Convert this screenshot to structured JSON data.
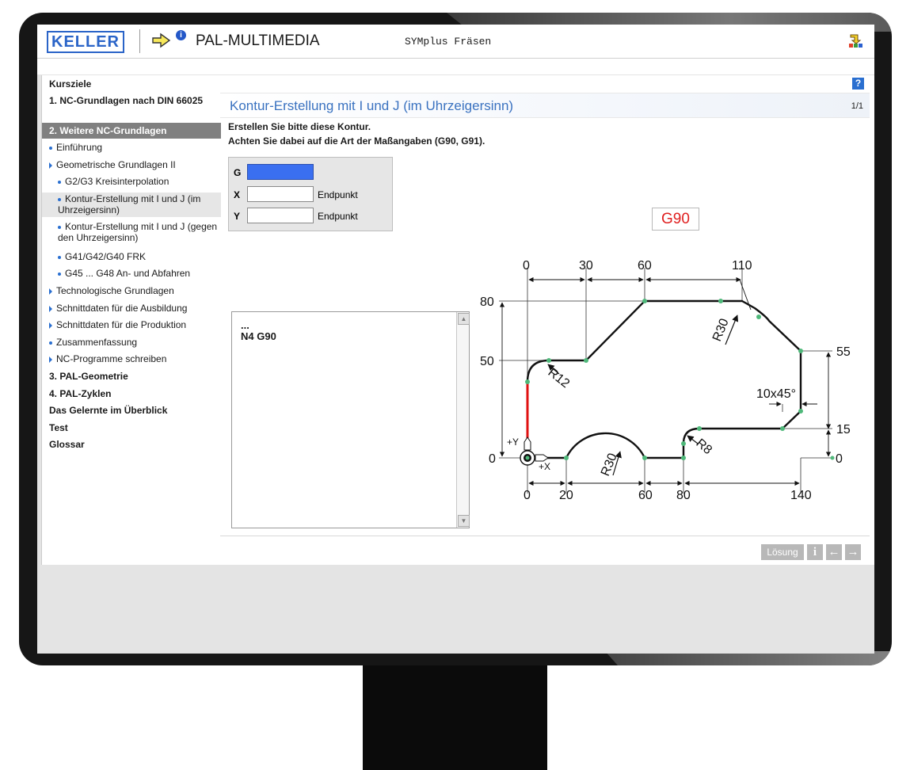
{
  "header": {
    "logo_text": "KELLER",
    "app_title": "PAL-MULTIMEDIA",
    "product": "SYMplus Fräsen",
    "info_badge": "i"
  },
  "nav": {
    "items": [
      {
        "label": "Kursziele"
      },
      {
        "label": "1. NC-Grundlagen nach DIN 66025"
      },
      {
        "label": "2. Weitere NC-Grundlagen"
      },
      {
        "label": "Einführung"
      },
      {
        "label": "Geometrische Grundlagen II"
      },
      {
        "label": "G2/G3 Kreisinterpolation"
      },
      {
        "label": "Kontur-Erstellung mit I und J (im Uhrzeigersinn)"
      },
      {
        "label": "Kontur-Erstellung mit I und J (gegen den Uhrzeigersinn)"
      },
      {
        "label": "G41/G42/G40 FRK"
      },
      {
        "label": "G45 ... G48 An- und Abfahren"
      },
      {
        "label": "Technologische Grundlagen"
      },
      {
        "label": "Schnittdaten für die Ausbildung"
      },
      {
        "label": "Schnittdaten für die Produktion"
      },
      {
        "label": "Zusammenfassung"
      },
      {
        "label": "NC-Programme schreiben"
      },
      {
        "label": "3. PAL-Geometrie"
      },
      {
        "label": "4. PAL-Zyklen"
      },
      {
        "label": "Das Gelernte im Überblick"
      },
      {
        "label": "Test"
      },
      {
        "label": "Glossar"
      }
    ]
  },
  "main": {
    "help": "?",
    "title": "Kontur-Erstellung mit I und J (im Uhrzeigersinn)",
    "page": "1/1",
    "instruction_1": "Erstellen Sie bitte diese Kontur.",
    "instruction_2": "Achten Sie dabei auf die Art der Maßangaben (G90, G91).",
    "inputs": [
      {
        "label": "G",
        "value": "",
        "hint": ""
      },
      {
        "label": "X",
        "value": "",
        "hint": "Endpunkt"
      },
      {
        "label": "Y",
        "value": "",
        "hint": "Endpunkt"
      }
    ],
    "code_lines": [
      "...",
      "N4 G90"
    ],
    "mode_badge": "G90"
  },
  "drawing": {
    "top_dims": [
      "0",
      "30",
      "60",
      "110"
    ],
    "bottom_dims": [
      "0",
      "20",
      "60",
      "80",
      "140"
    ],
    "left_dims": [
      "80",
      "50",
      "0"
    ],
    "right_dims": [
      "55",
      "15",
      "0"
    ],
    "radii": [
      "R30",
      "R12",
      "R30",
      "R8"
    ],
    "chamfer": "10x45°",
    "axis_x": "+X",
    "axis_y": "+Y"
  },
  "buttons": {
    "solution": "Lösung",
    "info": "i",
    "back": "←",
    "forward": "→"
  },
  "colors": {
    "accent": "#2a6fd0",
    "title": "#3a72c0",
    "active_nav": "#808080",
    "mode_badge": "#e02020",
    "contour_done": "#e01010",
    "points": "#4fb87a"
  }
}
